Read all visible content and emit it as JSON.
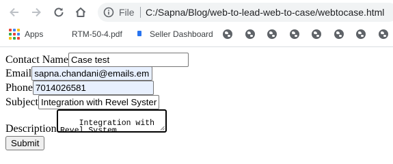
{
  "browser": {
    "file_label": "File",
    "url": "C:/Sapna/Blog/web-to-lead-web-to-case/webtocase.html"
  },
  "bookmarks": {
    "apps": "Apps",
    "items": [
      {
        "label": "RTM-50-4.pdf"
      },
      {
        "label": "Seller Dashboard"
      }
    ],
    "globe_count": 8
  },
  "form": {
    "contact_name": {
      "label": "Contact Name",
      "value": "Case test"
    },
    "email": {
      "label": "Email",
      "value": "sapna.chandani@emails.em"
    },
    "phone": {
      "label": "Phone",
      "value": "7014026581"
    },
    "subject": {
      "label": "Subject",
      "value": "Integration with Revel Syster"
    },
    "description": {
      "label": "Description",
      "value": "Integration with\nRevel System"
    },
    "submit": "Submit"
  },
  "colors": {
    "autofill_bg": "#e8f0fe",
    "chrome_icon": "#5f6368"
  }
}
